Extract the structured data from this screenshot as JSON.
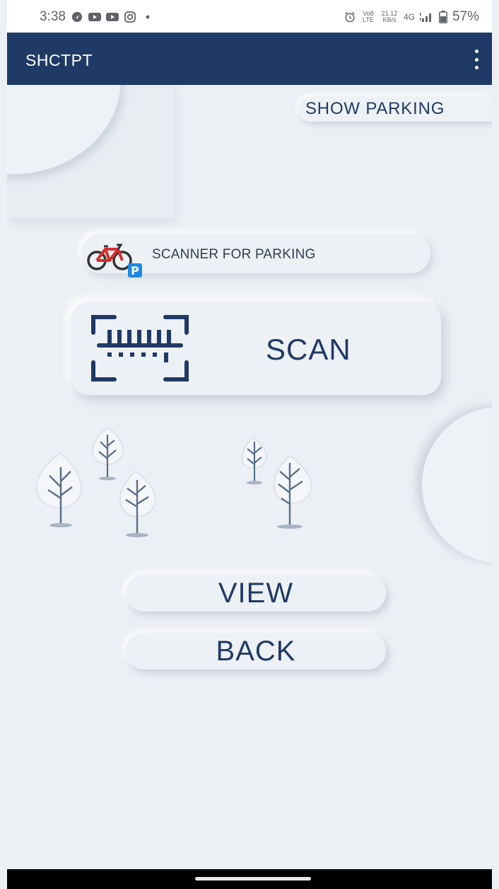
{
  "status_bar": {
    "time": "3:38",
    "left_icons": [
      "navigation-icon",
      "youtube-icon",
      "youtube-icon",
      "instagram-icon",
      "dot-icon"
    ],
    "alarm_icon": "alarm-icon",
    "volte_label": "Vo8 LTE",
    "data_rate_value": "21.12",
    "data_rate_unit": "KB/s",
    "network_label": "4G",
    "battery_percent": "57%"
  },
  "app_bar": {
    "title": "SHCTPT",
    "menu_icon": "more-vert-icon"
  },
  "main": {
    "show_parking_label": "SHOW PARKING",
    "scanner_label": "SCANNER FOR PARKING",
    "scanner_icon": "bike-parking-icon",
    "scan_icon": "barcode-scan-icon",
    "scan_label": "SCAN",
    "view_label": "VIEW",
    "back_label": "BACK"
  },
  "colors": {
    "app_bar": "#1f3a66",
    "background": "#eceff3",
    "text_primary": "#1f3a66",
    "parking_badge": "#1e88e5",
    "bike_red": "#d32f2f"
  }
}
